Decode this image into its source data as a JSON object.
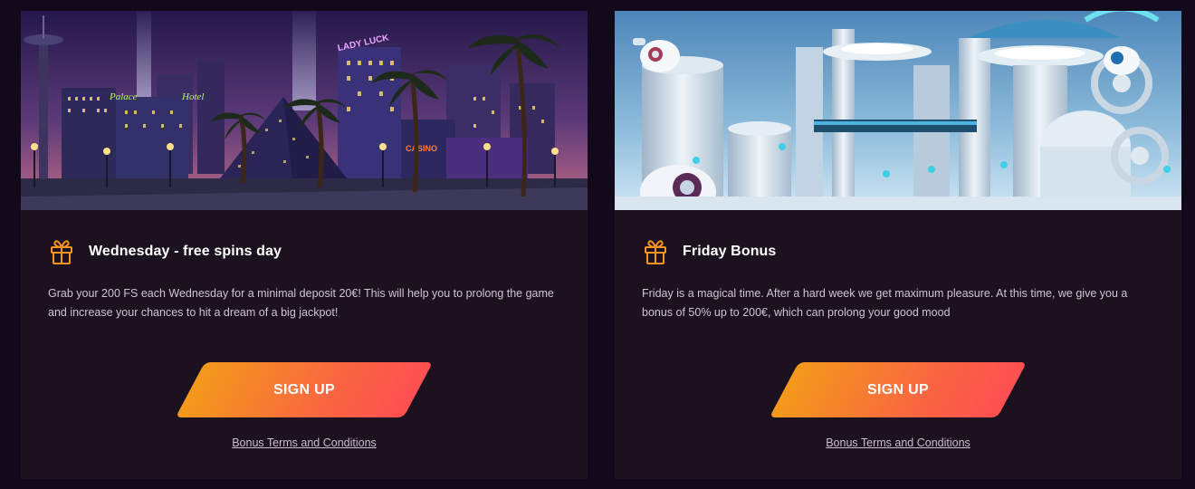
{
  "colors": {
    "page_background": "#12091a",
    "card_background": "#1c111f",
    "accent_gift": "#f7931e",
    "button_gradient_start": "#f39a1b",
    "button_gradient_end": "#fd4f52"
  },
  "promotions": [
    {
      "title": "Wednesday - free spins day",
      "icon": "gift-icon",
      "banner": "night-city-banner",
      "description": "Grab your 200 FS each Wednesday for a minimal deposit 20€! This will help you to prolong the game and increase your chances to hit a dream of a big jackpot!",
      "signup_label": "SIGN UP",
      "terms_label": "Bonus Terms and Conditions",
      "banner_signs": [
        "LADY LUCK",
        "Palace",
        "Hotel",
        "CASINO"
      ]
    },
    {
      "title": "Friday Bonus",
      "icon": "gift-icon",
      "banner": "futuristic-city-banner",
      "description": "Friday is a magical time. After a hard week we get maximum pleasure. At this time, we give you a bonus of 50% up to 200€, which can prolong your good mood",
      "signup_label": "SIGN UP",
      "terms_label": "Bonus Terms and Conditions"
    }
  ]
}
